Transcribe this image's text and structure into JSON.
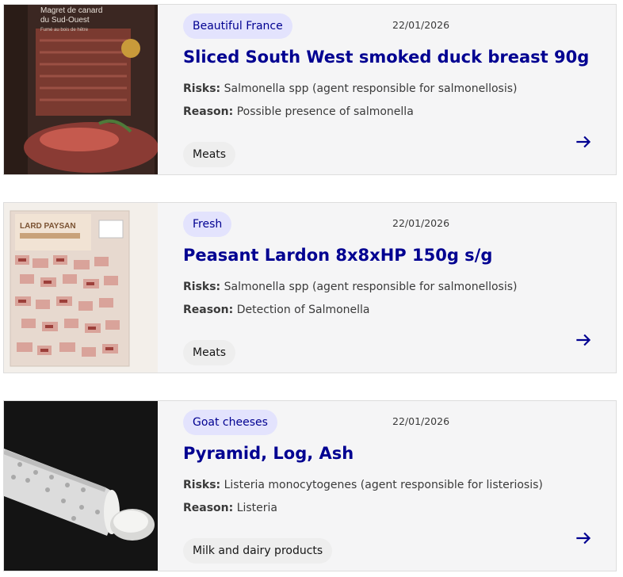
{
  "cards": [
    {
      "category_tag": "Beautiful France",
      "date": "22/01/2026",
      "title": "Sliced South West smoked duck breast 90g",
      "risks_label": "Risks:",
      "risks_text": " Salmonella spp (agent responsible for salmonellosis)",
      "reason_label": "Reason:",
      "reason_text": " Possible presence of salmonella",
      "chip": "Meats",
      "image_text": [
        "Magret de canard",
        "du Sud-Ouest",
        "Fumé au bois de hêtre"
      ]
    },
    {
      "category_tag": "Fresh",
      "date": "22/01/2026",
      "title": "Peasant Lardon 8x8xHP 150g s/g",
      "risks_label": "Risks:",
      "risks_text": " Salmonella spp (agent responsible for salmonellosis)",
      "reason_label": "Reason:",
      "reason_text": " Detection of Salmonella",
      "chip": "Meats",
      "image_text": [
        "LARD PAYSAN"
      ]
    },
    {
      "category_tag": "Goat cheeses",
      "date": "22/01/2026",
      "title": "Pyramid, Log, Ash",
      "risks_label": "Risks:",
      "risks_text": " Listeria monocytogenes (agent responsible for listeriosis)",
      "reason_label": "Reason:",
      "reason_text": " Listeria",
      "chip": "Milk and dairy products",
      "image_text": []
    }
  ],
  "icons": {
    "arrow": "arrow-right-icon"
  },
  "colors": {
    "accent": "#000091",
    "tag_bg": "#e3e3fd",
    "card_bg": "#f5f5f6"
  }
}
